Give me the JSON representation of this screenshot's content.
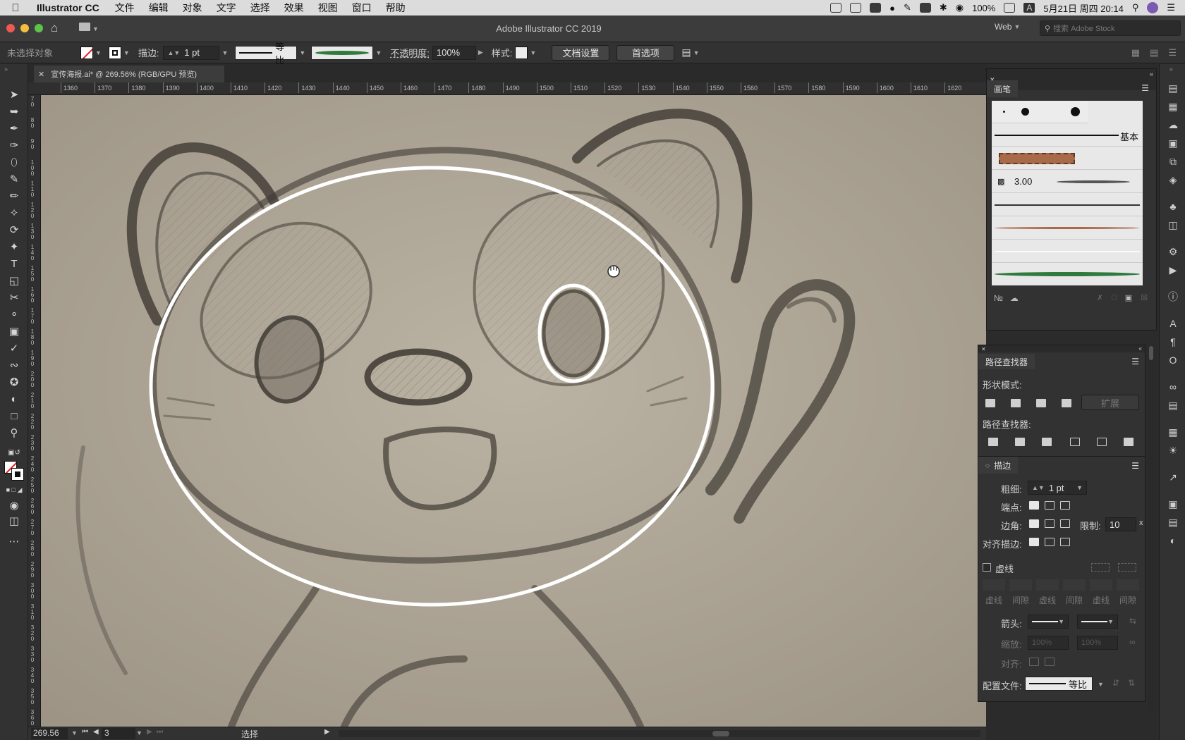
{
  "menubar": {
    "app_name": "Illustrator CC",
    "items": [
      "文件",
      "编辑",
      "对象",
      "文字",
      "选择",
      "效果",
      "视图",
      "窗口",
      "帮助"
    ],
    "battery": "100%",
    "datetime": "5月21日 周四  20:14",
    "input_badge": "A"
  },
  "window": {
    "title": "Adobe Illustrator CC 2019",
    "workspace": "Web",
    "stock_search_placeholder": "搜索 Adobe Stock"
  },
  "control_bar": {
    "selection_status": "未选择对象",
    "stroke_label": "描边:",
    "stroke_weight": "1 pt",
    "profile_label": "等比",
    "opacity_label": "不透明度:",
    "opacity_value": "100%",
    "style_label": "样式:",
    "doc_setup_button": "文档设置",
    "preferences_button": "首选项"
  },
  "document": {
    "tab_label": "宣传海报.ai* @ 269.56% (RGB/GPU 预览)"
  },
  "rulers": {
    "horizontal": [
      "1360",
      "1370",
      "1380",
      "1390",
      "1400",
      "1410",
      "1420",
      "1430",
      "1440",
      "1450",
      "1460",
      "1470",
      "1480",
      "1490",
      "1500",
      "1510",
      "1520",
      "1530",
      "1540",
      "1550",
      "1560",
      "1570",
      "1580",
      "1590",
      "1600",
      "1610",
      "1620"
    ],
    "vertical": [
      "70",
      "80",
      "90",
      "100",
      "110",
      "120",
      "130",
      "140",
      "150",
      "160",
      "170",
      "180",
      "190",
      "200",
      "210",
      "220",
      "230",
      "240",
      "250",
      "260",
      "270",
      "280",
      "290",
      "300",
      "310",
      "320",
      "330",
      "340",
      "350",
      "360"
    ]
  },
  "status_bar": {
    "zoom": "269.56",
    "artboard": "3",
    "tool_status": "选择"
  },
  "brush_panel": {
    "title": "画笔",
    "basic_label": "基本",
    "brush_size": "3.00",
    "colors": {
      "brown": "#a86a48",
      "green": "#2f7a3c"
    }
  },
  "pathfinder_panel": {
    "title": "路径查找器",
    "shape_modes_label": "形状模式:",
    "expand_button": "扩展",
    "pathfinders_label": "路径查找器:"
  },
  "stroke_panel": {
    "title": "描边",
    "weight_label": "粗细:",
    "weight_value": "1 pt",
    "cap_label": "端点:",
    "corner_label": "边角:",
    "limit_label": "限制:",
    "limit_value": "10",
    "limit_unit": "x",
    "align_label": "对齐描边:",
    "dashed_label": "虚线",
    "dash_labels": [
      "虚线",
      "间隙",
      "虚线",
      "间隙",
      "虚线",
      "间隙"
    ],
    "arrowheads_label": "箭头:",
    "scale_label": "缩放:",
    "scale_value_1": "100%",
    "scale_value_2": "100%",
    "align_arrow_label": "对齐:",
    "profile_label": "配置文件:",
    "profile_value": "等比"
  },
  "colors": {
    "canvas_paper": "#aea595",
    "ui_dark": "#323232",
    "selection_path": "#ffffff"
  }
}
